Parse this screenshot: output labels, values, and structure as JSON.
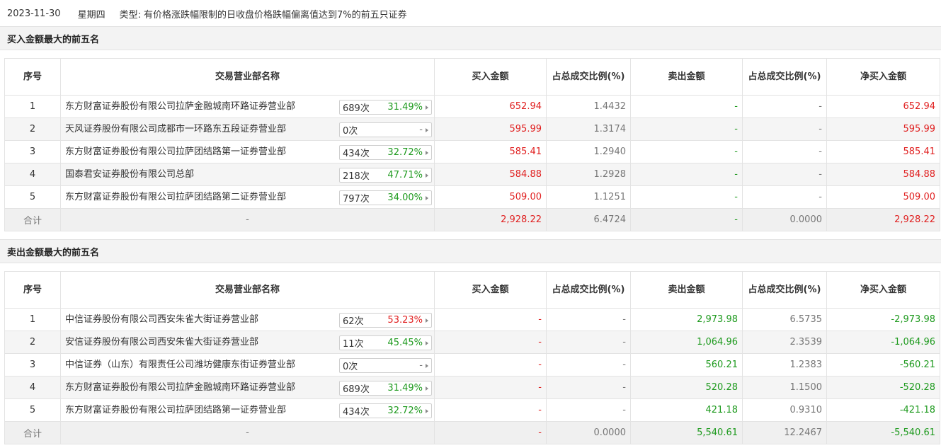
{
  "info": {
    "date": "2023-11-30",
    "weekday": "星期四",
    "type_label": "类型:",
    "type_text": "有价格涨跌幅限制的日收盘价格跌幅偏离值达到7%的前五只证券"
  },
  "columns": {
    "seq": "序号",
    "branch": "交易营业部名称",
    "buy_amount": "买入金额",
    "buy_ratio": "占总成交比例(%)",
    "sell_amount": "卖出金额",
    "sell_ratio": "占总成交比例(%)",
    "net_buy": "净买入金额"
  },
  "buy_section": {
    "title": "买入金额最大的前五名",
    "rows": [
      {
        "seq": "1",
        "branch": "东方财富证券股份有限公司拉萨金融城南环路证券营业部",
        "times": "689次",
        "rate": "31.49%",
        "buy": "652.94",
        "buy_ratio": "1.4432",
        "sell": "-",
        "sell_ratio": "-",
        "net": "652.94"
      },
      {
        "seq": "2",
        "branch": "天风证券股份有限公司成都市一环路东五段证券营业部",
        "times": "0次",
        "rate": "-",
        "buy": "595.99",
        "buy_ratio": "1.3174",
        "sell": "-",
        "sell_ratio": "-",
        "net": "595.99"
      },
      {
        "seq": "3",
        "branch": "东方财富证券股份有限公司拉萨团结路第一证券营业部",
        "times": "434次",
        "rate": "32.72%",
        "buy": "585.41",
        "buy_ratio": "1.2940",
        "sell": "-",
        "sell_ratio": "-",
        "net": "585.41"
      },
      {
        "seq": "4",
        "branch": "国泰君安证券股份有限公司总部",
        "times": "218次",
        "rate": "47.71%",
        "buy": "584.88",
        "buy_ratio": "1.2928",
        "sell": "-",
        "sell_ratio": "-",
        "net": "584.88"
      },
      {
        "seq": "5",
        "branch": "东方财富证券股份有限公司拉萨团结路第二证券营业部",
        "times": "797次",
        "rate": "34.00%",
        "buy": "509.00",
        "buy_ratio": "1.1251",
        "sell": "-",
        "sell_ratio": "-",
        "net": "509.00"
      }
    ],
    "total": {
      "label": "合计",
      "branch": "-",
      "buy": "2,928.22",
      "buy_ratio": "6.4724",
      "sell": "-",
      "sell_ratio": "0.0000",
      "net": "2,928.22"
    }
  },
  "sell_section": {
    "title": "卖出金额最大的前五名",
    "rows": [
      {
        "seq": "1",
        "branch": "中信证券股份有限公司西安朱雀大街证券营业部",
        "times": "62次",
        "rate": "53.23%",
        "buy": "-",
        "buy_ratio": "-",
        "sell": "2,973.98",
        "sell_ratio": "6.5735",
        "net": "-2,973.98"
      },
      {
        "seq": "2",
        "branch": "安信证券股份有限公司西安朱雀大街证券营业部",
        "times": "11次",
        "rate": "45.45%",
        "buy": "-",
        "buy_ratio": "-",
        "sell": "1,064.96",
        "sell_ratio": "2.3539",
        "net": "-1,064.96"
      },
      {
        "seq": "3",
        "branch": "中信证券（山东）有限责任公司潍坊健康东街证券营业部",
        "times": "0次",
        "rate": "-",
        "buy": "-",
        "buy_ratio": "-",
        "sell": "560.21",
        "sell_ratio": "1.2383",
        "net": "-560.21"
      },
      {
        "seq": "4",
        "branch": "东方财富证券股份有限公司拉萨金融城南环路证券营业部",
        "times": "689次",
        "rate": "31.49%",
        "buy": "-",
        "buy_ratio": "-",
        "sell": "520.28",
        "sell_ratio": "1.1500",
        "net": "-520.28"
      },
      {
        "seq": "5",
        "branch": "东方财富证券股份有限公司拉萨团结路第一证券营业部",
        "times": "434次",
        "rate": "32.72%",
        "buy": "-",
        "buy_ratio": "-",
        "sell": "421.18",
        "sell_ratio": "0.9310",
        "net": "-421.18"
      }
    ],
    "total": {
      "label": "合计",
      "branch": "-",
      "buy": "-",
      "buy_ratio": "0.0000",
      "sell": "5,540.61",
      "sell_ratio": "12.2467",
      "net": "-5,540.61"
    }
  },
  "colors": {
    "positive": "#e01f1f",
    "negative": "#1e9a1e",
    "rate_green": "#1e9a1e",
    "rate_red": "#e01f1f"
  }
}
